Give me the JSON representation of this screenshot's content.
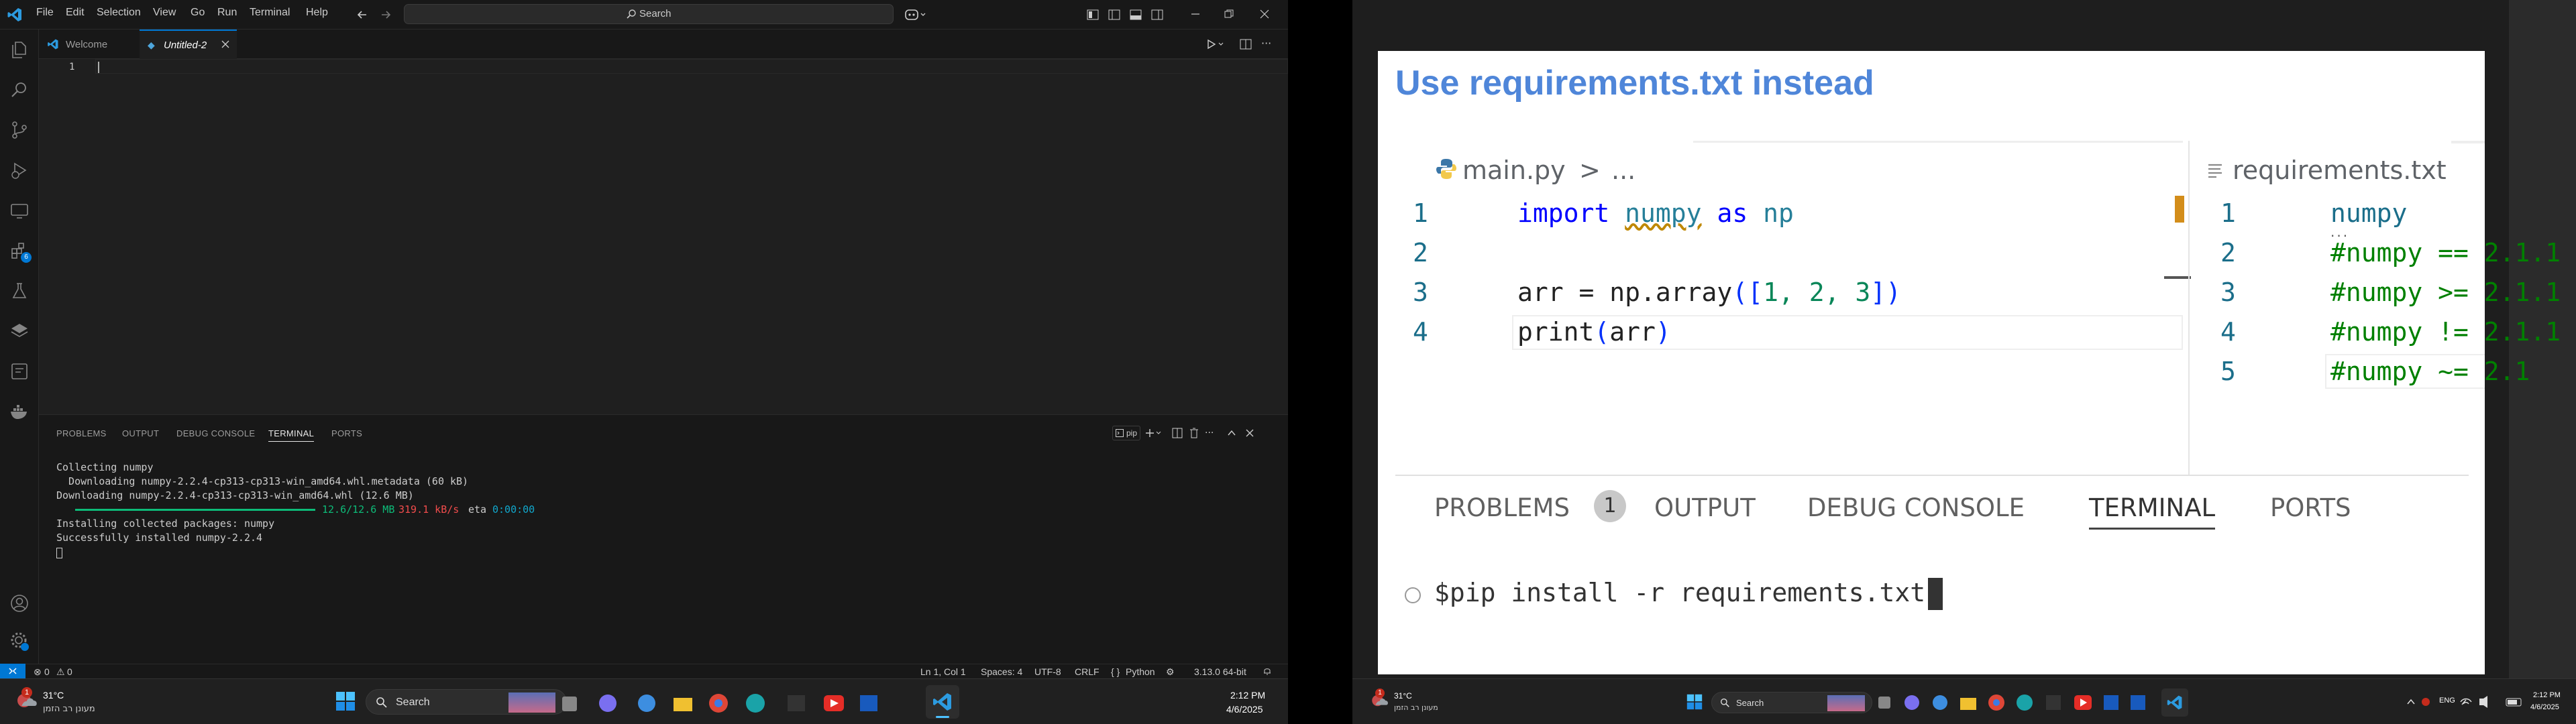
{
  "vscode": {
    "menu": [
      "File",
      "Edit",
      "Selection",
      "View",
      "Go",
      "Run",
      "Terminal",
      "Help"
    ],
    "search_label": "Search",
    "tabs": [
      {
        "label": "Welcome"
      },
      {
        "label": "Untitled-2"
      }
    ],
    "line_number": "1",
    "panel_tabs": [
      "PROBLEMS",
      "OUTPUT",
      "DEBUG CONSOLE",
      "TERMINAL",
      "PORTS"
    ],
    "terminal_name": "pip",
    "terminal_lines": {
      "l1": "Collecting numpy",
      "l2": "  Downloading numpy-2.2.4-cp313-cp313-win_amd64.whl.metadata (60 kB)",
      "l3": "Downloading numpy-2.2.4-cp313-cp313-win_amd64.whl (12.6 MB)",
      "progress_size": "12.6/12.6 MB",
      "progress_speed": "319.1 kB/s",
      "progress_eta_label": "eta",
      "progress_eta": "0:00:00",
      "progress_fraction": 1.0,
      "l5": "Installing collected packages: numpy",
      "l6": "Successfully installed numpy-2.2.4"
    },
    "status": {
      "errors": "0",
      "warnings": "0",
      "position": "Ln 1, Col 1",
      "spaces": "Spaces: 4",
      "encoding": "UTF-8",
      "eol": "CRLF",
      "language": "Python",
      "interpreter": "3.13.0 64-bit"
    },
    "extensions_badge": "6"
  },
  "taskbar1": {
    "weather_temp": "31°C",
    "weather_desc": "מעונן רב הזמן",
    "search": "Search",
    "time": "2:12 PM",
    "date": "4/6/2025",
    "weather_badge": "1"
  },
  "taskbar2": {
    "weather_temp": "31°C",
    "weather_desc": "מעונן רב הזמן",
    "search": "Search",
    "lang": "ENG",
    "time": "2:12 PM",
    "date": "4/6/2025",
    "weather_badge": "1"
  },
  "slide": {
    "title": "Use requirements.txt instead",
    "main_file": "main.py",
    "main_breadcrumb_sep": ">",
    "main_breadcrumb_rest": "...",
    "main_lines": {
      "n1": "1",
      "n2": "2",
      "n3": "3",
      "n4": "4",
      "kw_import": "import",
      "mod": "numpy",
      "kw_as": "as",
      "alias": "np",
      "l3_a": "arr = np.array",
      "l3_b": "([",
      "l3_c": "1, 2, 3",
      "l3_d": "])",
      "l4_a": "print",
      "l4_b": "(",
      "l4_c": "arr",
      "l4_d": ")"
    },
    "req_file": "requirements.txt",
    "req_lines": [
      {
        "n": "1",
        "text": "numpy"
      },
      {
        "n": "2",
        "text": "#numpy == 2.1.1"
      },
      {
        "n": "3",
        "text": "#numpy >= 2.1.1"
      },
      {
        "n": "4",
        "text": "#numpy != 2.1.1"
      },
      {
        "n": "5",
        "text": "#numpy ~= 2.1"
      }
    ],
    "panel_tabs": [
      "PROBLEMS",
      "OUTPUT",
      "DEBUG CONSOLE",
      "TERMINAL",
      "PORTS"
    ],
    "problems_count": "1",
    "command": "$pip install -r requirements.txt"
  },
  "colors": {
    "accent": "#0078d4",
    "vscode_blue": "#007acc",
    "title_blue": "#4f86d9",
    "green": "#0dbc79",
    "red": "#f14c4c",
    "cyan": "#11a8cd"
  }
}
